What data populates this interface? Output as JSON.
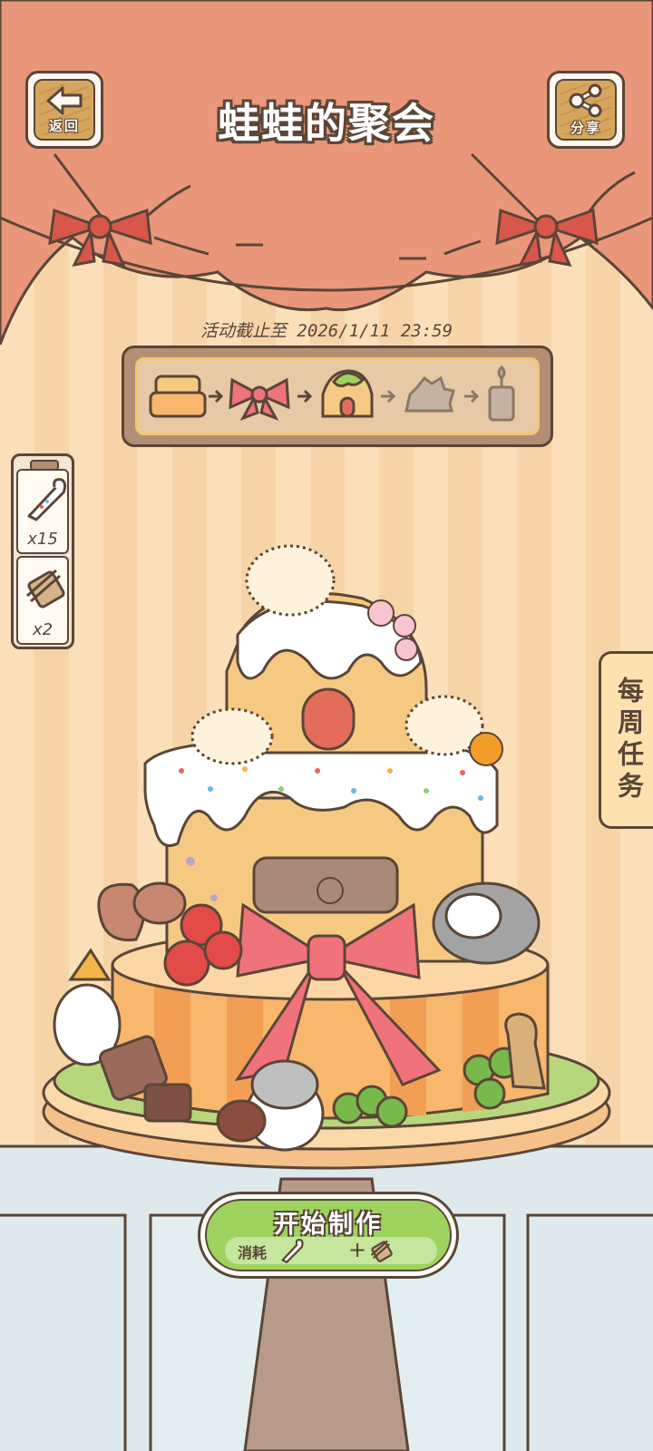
{
  "header": {
    "title": "蛙蛙的聚会",
    "back_label": "返回",
    "share_label": "分享"
  },
  "event": {
    "deadline_text": "活动截止至 2026/1/11 23:59",
    "progress_steps": [
      "cake-base-icon",
      "ribbon-bow-icon",
      "cake-house-icon",
      "hedgehog-icon",
      "candle-icon"
    ],
    "completed_steps": 3
  },
  "inventory": {
    "items": [
      {
        "icon": "piping-bag-icon",
        "count": "x15"
      },
      {
        "icon": "cookie-sticks-icon",
        "count": "x2"
      }
    ]
  },
  "weekly_tasks": {
    "label": "每周任务"
  },
  "start_button": {
    "label": "开始制作",
    "cost_label": "消耗",
    "plus": "+"
  },
  "colors": {
    "curtain": "#e9967a",
    "wall": "#f6d4a8",
    "outline": "#5a4638",
    "button_green": "#9fd35f",
    "wood": "#d7a65e"
  }
}
